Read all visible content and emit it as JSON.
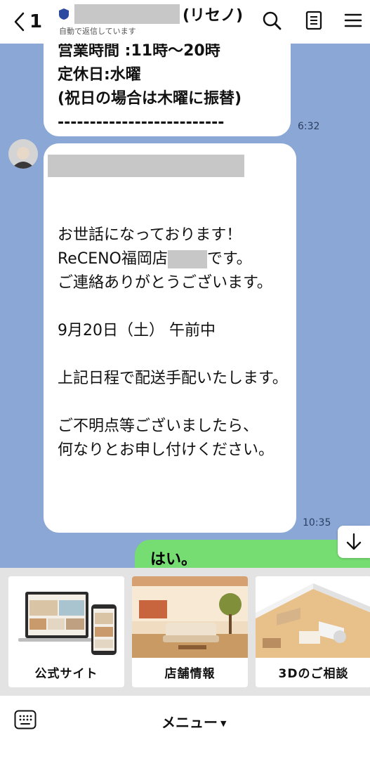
{
  "header": {
    "back_count": "1",
    "title_suffix": "(リセノ)",
    "subtitle": "自動で返信しています"
  },
  "messages": {
    "first_tail": "営業時間 :11時～20時\n定休日:水曜\n(祝日の場合は木曜に振替)\n--------------------------",
    "first_time": "6:32",
    "second_body_line1": "お世話になっております！\nReCENO福岡店",
    "second_body_line1_end": "です。",
    "second_body_rest": "ご連絡ありがとうございます。\n\n9月20日（土） 午前中\n\n上記日程で配送手配いたします。\n\nご不明点等ございましたら、\n何なりとお申し付けください。",
    "second_time": "10:35",
    "outgoing": "はい。"
  },
  "rich_menu": {
    "cards": [
      {
        "label": "公式サイト"
      },
      {
        "label": "店舗情報"
      },
      {
        "label": "3Dのご相談"
      }
    ]
  },
  "bottom_bar": {
    "menu_label": "メニュー"
  }
}
